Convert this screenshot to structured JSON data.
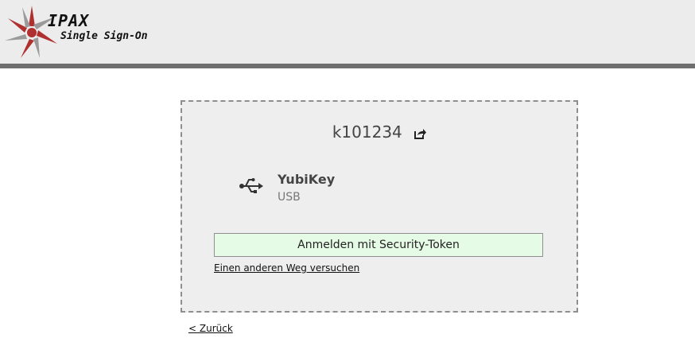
{
  "header": {
    "logo_word": "IPAX",
    "subtitle": "Single Sign-On",
    "logo_colors": {
      "red": "#b03030",
      "gray": "#9a9a9a"
    }
  },
  "card": {
    "username": "k101234",
    "username_action_icon": "share-icon",
    "token": {
      "icon": "usb-icon",
      "name": "YubiKey",
      "type": "USB"
    },
    "login_button_label": "Anmelden mit Security-Token",
    "login_button_color": "#e6fbe6",
    "other_way_label": "Einen anderen Weg versuchen"
  },
  "back_link_label": "< Zurück"
}
